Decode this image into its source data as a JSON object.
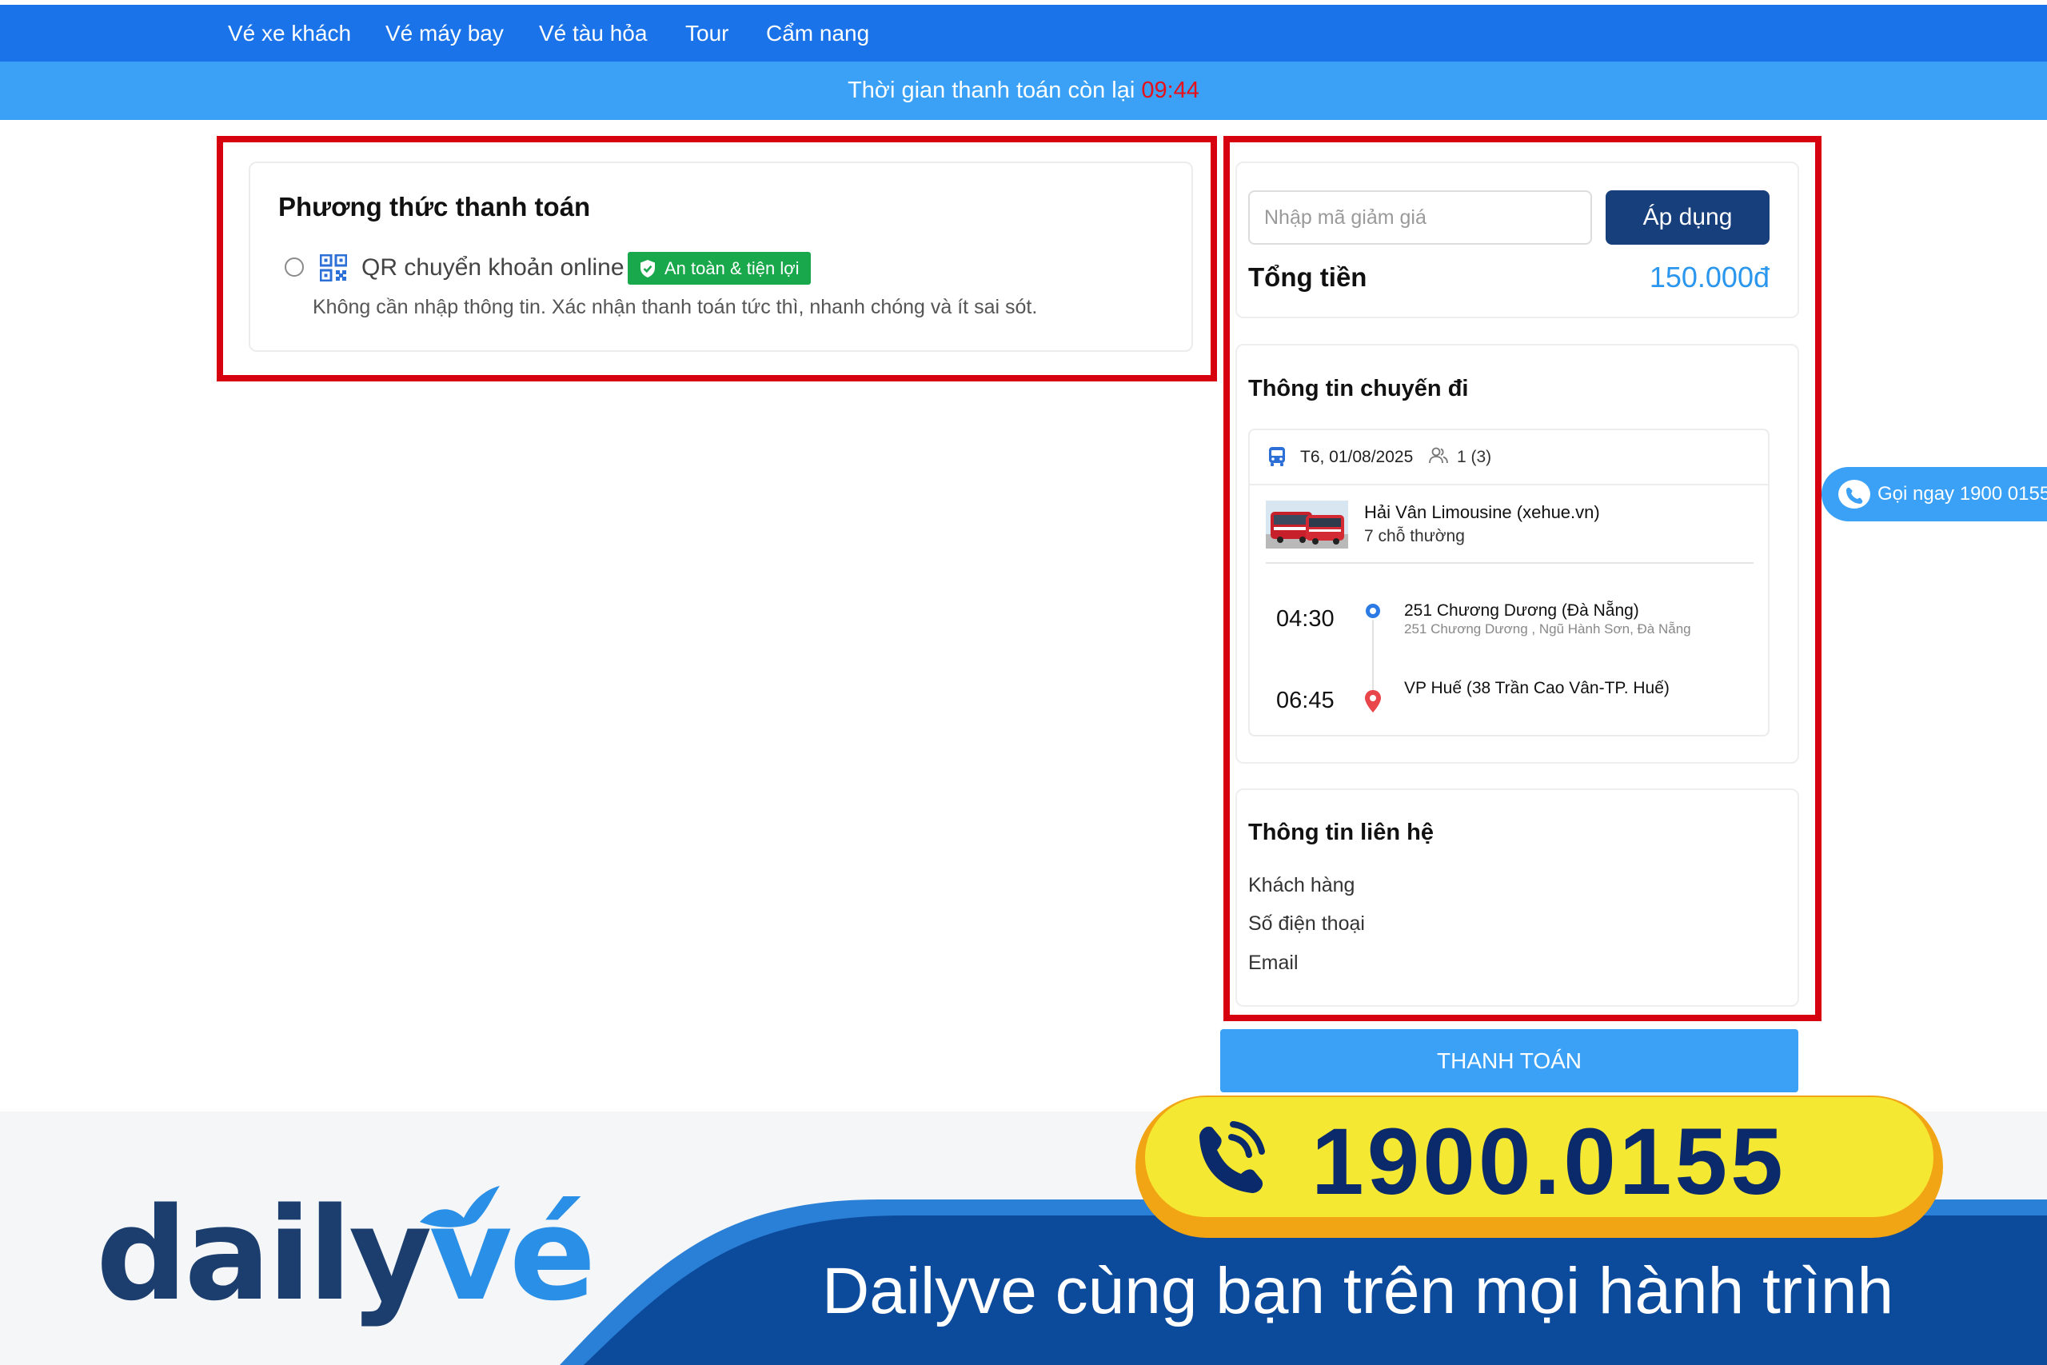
{
  "nav": {
    "items": [
      "Vé xe khách",
      "Vé máy bay",
      "Vé tàu hỏa",
      "Tour",
      "Cẩm nang"
    ]
  },
  "timer": {
    "label": "Thời gian thanh toán còn lại",
    "value": "09:44"
  },
  "payment": {
    "title": "Phương thức thanh toán",
    "method_label": "QR chuyển khoản online",
    "badge": "An toàn & tiện lợi",
    "description": "Không cần nhập thông tin. Xác nhận thanh toán tức thì, nhanh chóng và ít sai sót."
  },
  "summary": {
    "coupon_placeholder": "Nhập mã giảm giá",
    "apply_label": "Áp dụng",
    "total_label": "Tổng tiền",
    "total_value": "150.000đ"
  },
  "trip": {
    "title": "Thông tin chuyến đi",
    "date": "T6, 01/08/2025",
    "passengers": "1 (3)",
    "operator": "Hải Vân Limousine (xehue.vn)",
    "seat_type": "7 chỗ thường",
    "depart_time": "04:30",
    "depart_stop": "251 Chương Dương (Đà Nẵng)",
    "depart_address": "251 Chương Dương , Ngũ Hành Sơn, Đà Nẵng",
    "arrive_time": "06:45",
    "arrive_stop": "VP Huế (38 Trần Cao Vân-TP. Huế)"
  },
  "contact": {
    "title": "Thông tin liên hệ",
    "rows": [
      "Khách hàng",
      "Số điện thoại",
      "Email"
    ]
  },
  "pay_button": "THANH TOÁN",
  "float_call": "Gọi ngay 1900 0155",
  "banner": {
    "logo_main": "daily",
    "logo_accent": "vé",
    "hotline": "1900.0155",
    "slogan": "Dailyve cùng bạn trên mọi hành trình"
  },
  "colors": {
    "nav_bg": "#1a73e8",
    "timer_bg": "#3aa1f6",
    "timer_value": "#e8111a",
    "apply_btn": "#173f7c",
    "total_value": "#2a96ee",
    "badge_green": "#1aa84c",
    "highlight_frame": "#d7000f"
  },
  "icons": [
    "qr-code-icon",
    "shield-check-icon",
    "bus-icon",
    "passenger-icon",
    "start-dot-icon",
    "map-pin-icon",
    "phone-icon"
  ]
}
